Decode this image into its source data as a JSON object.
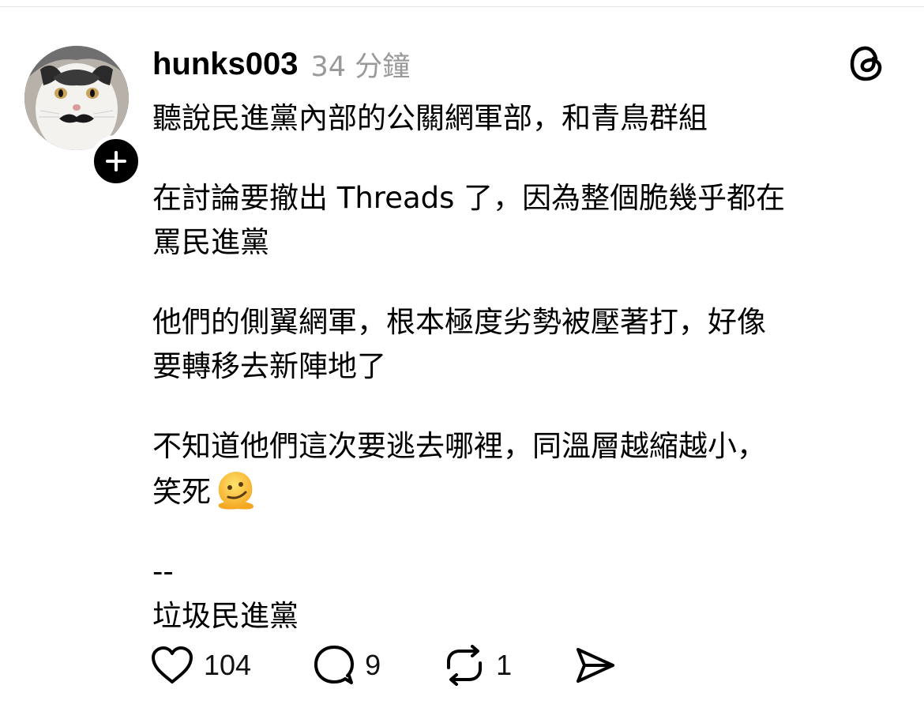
{
  "post": {
    "username": "hunks003",
    "time": "34 分鐘",
    "paragraphs": [
      [
        "聽說民進黨內部的公關網軍部，和青鳥群組"
      ],
      [
        "在討論要撤出 Threads 了，因為整個脆幾乎都在",
        "罵民進黨"
      ],
      [
        "他們的側翼網軍，根本極度劣勢被壓著打，好像",
        "要轉移去新陣地了"
      ],
      [
        "不知道他們這次要逃去哪裡，同溫層越縮越小，",
        "笑死"
      ],
      [
        "--",
        "垃圾民進黨"
      ]
    ],
    "emoji": "melting-face-emoji",
    "actions": {
      "likes": "104",
      "replies": "9",
      "reposts": "1"
    }
  },
  "icons": {
    "avatar": "cat-avatar",
    "follow": "plus-icon",
    "logo": "threads-logo-icon",
    "like": "heart-icon",
    "reply": "comment-bubble-icon",
    "repost": "repost-icon",
    "share": "send-icon"
  },
  "colors": {
    "text": "#000000",
    "muted": "#999999",
    "divider": "#e6e6e6"
  }
}
